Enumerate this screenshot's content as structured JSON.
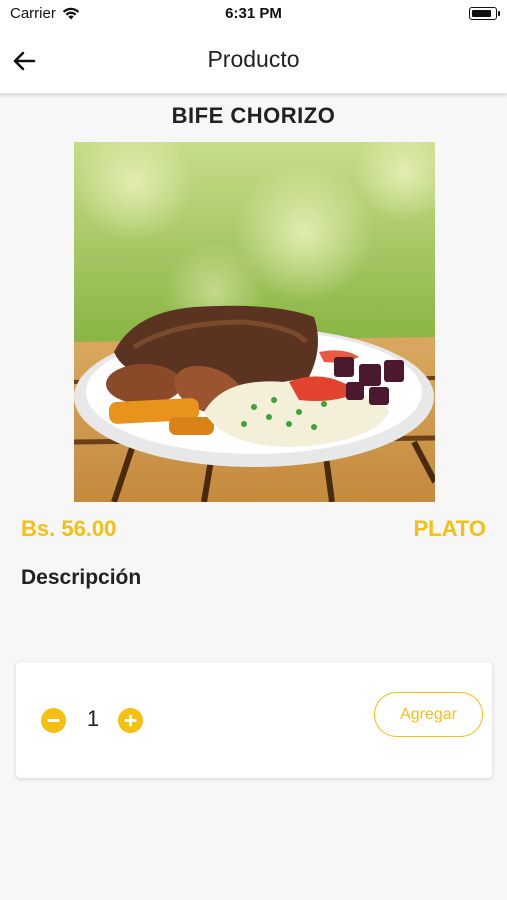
{
  "status_bar": {
    "carrier": "Carrier",
    "time": "6:31 PM",
    "battery_level": 0.9
  },
  "header": {
    "title": "Producto",
    "back_icon": "arrow-left-icon"
  },
  "product": {
    "name": "BIFE CHORIZO",
    "price": "Bs. 56.00",
    "unit": "PLATO",
    "description_title": "Descripción"
  },
  "cart": {
    "quantity": "1",
    "decrement_icon": "minus-circle-icon",
    "increment_icon": "plus-circle-icon",
    "add_label": "Agregar"
  },
  "colors": {
    "accent": "#f6bf12",
    "background": "#f7f7f7",
    "text": "#222222"
  }
}
